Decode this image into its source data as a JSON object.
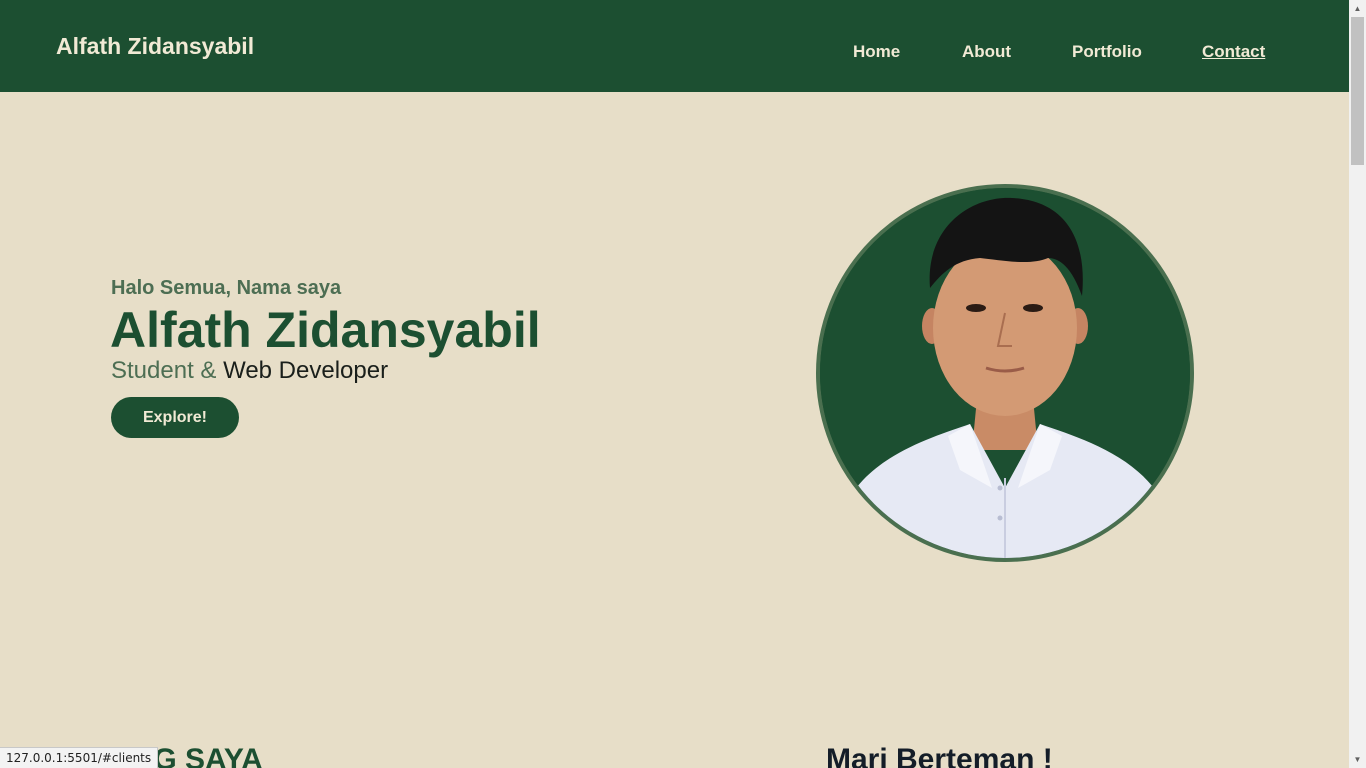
{
  "navbar": {
    "brand": "Alfath Zidansyabil",
    "links": [
      {
        "label": "Home"
      },
      {
        "label": "About"
      },
      {
        "label": "Portfolio"
      },
      {
        "label": "Contact"
      }
    ]
  },
  "hero": {
    "greeting": "Halo Semua, Nama saya",
    "name": "Alfath Zidansyabil",
    "role_part1": "Student &",
    "role_part2": "Web Developer",
    "cta_label": "Explore!"
  },
  "sections": {
    "left_title": "ANG SAYA",
    "right_title": "Mari Berteman !"
  },
  "status_bar": {
    "url": "127.0.0.1:5501/#clients"
  },
  "colors": {
    "brand_green": "#1c4f31",
    "background": "#e7dec8",
    "cream_text": "#f1ead5"
  },
  "icons": {
    "scroll_up": "▲",
    "scroll_down": "▼"
  }
}
